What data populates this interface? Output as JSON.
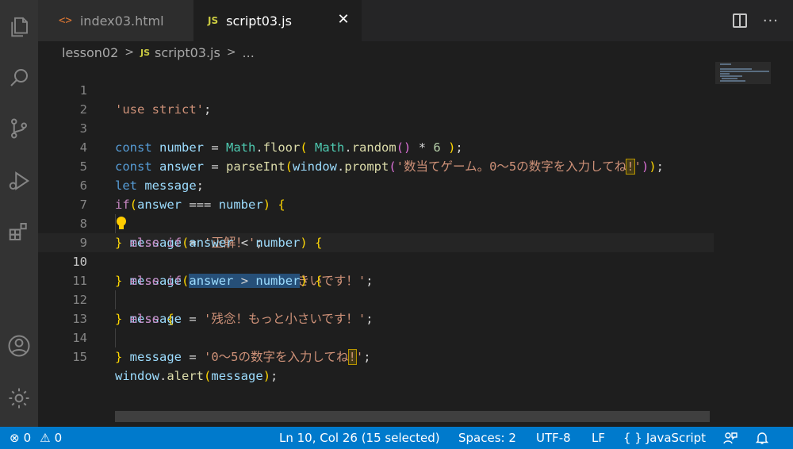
{
  "tabs": [
    {
      "icon": "<>",
      "label": "index03.html"
    },
    {
      "icon": "JS",
      "label": "script03.js",
      "close": "✕"
    }
  ],
  "tab_actions": {
    "more": "···"
  },
  "breadcrumb": {
    "folder": "lesson02",
    "file_icon": "JS",
    "file": "script03.js",
    "tail": "..."
  },
  "editor": {
    "line_numbers": [
      "1",
      "2",
      "3",
      "4",
      "5",
      "6",
      "7",
      "8",
      "9",
      "10",
      "11",
      "12",
      "13",
      "14",
      "15"
    ],
    "current_line": "10"
  },
  "status": {
    "errors": "0",
    "warnings": "0",
    "position": "Ln 10, Col 26 (15 selected)",
    "spaces": "Spaces: 2",
    "encoding": "UTF-8",
    "eol": "LF",
    "language_icon": "{ }",
    "language": "JavaScript"
  },
  "colors": {
    "status_bar": "#007acc",
    "selection": "#264f78",
    "editor_bg": "#1e1e1e"
  }
}
